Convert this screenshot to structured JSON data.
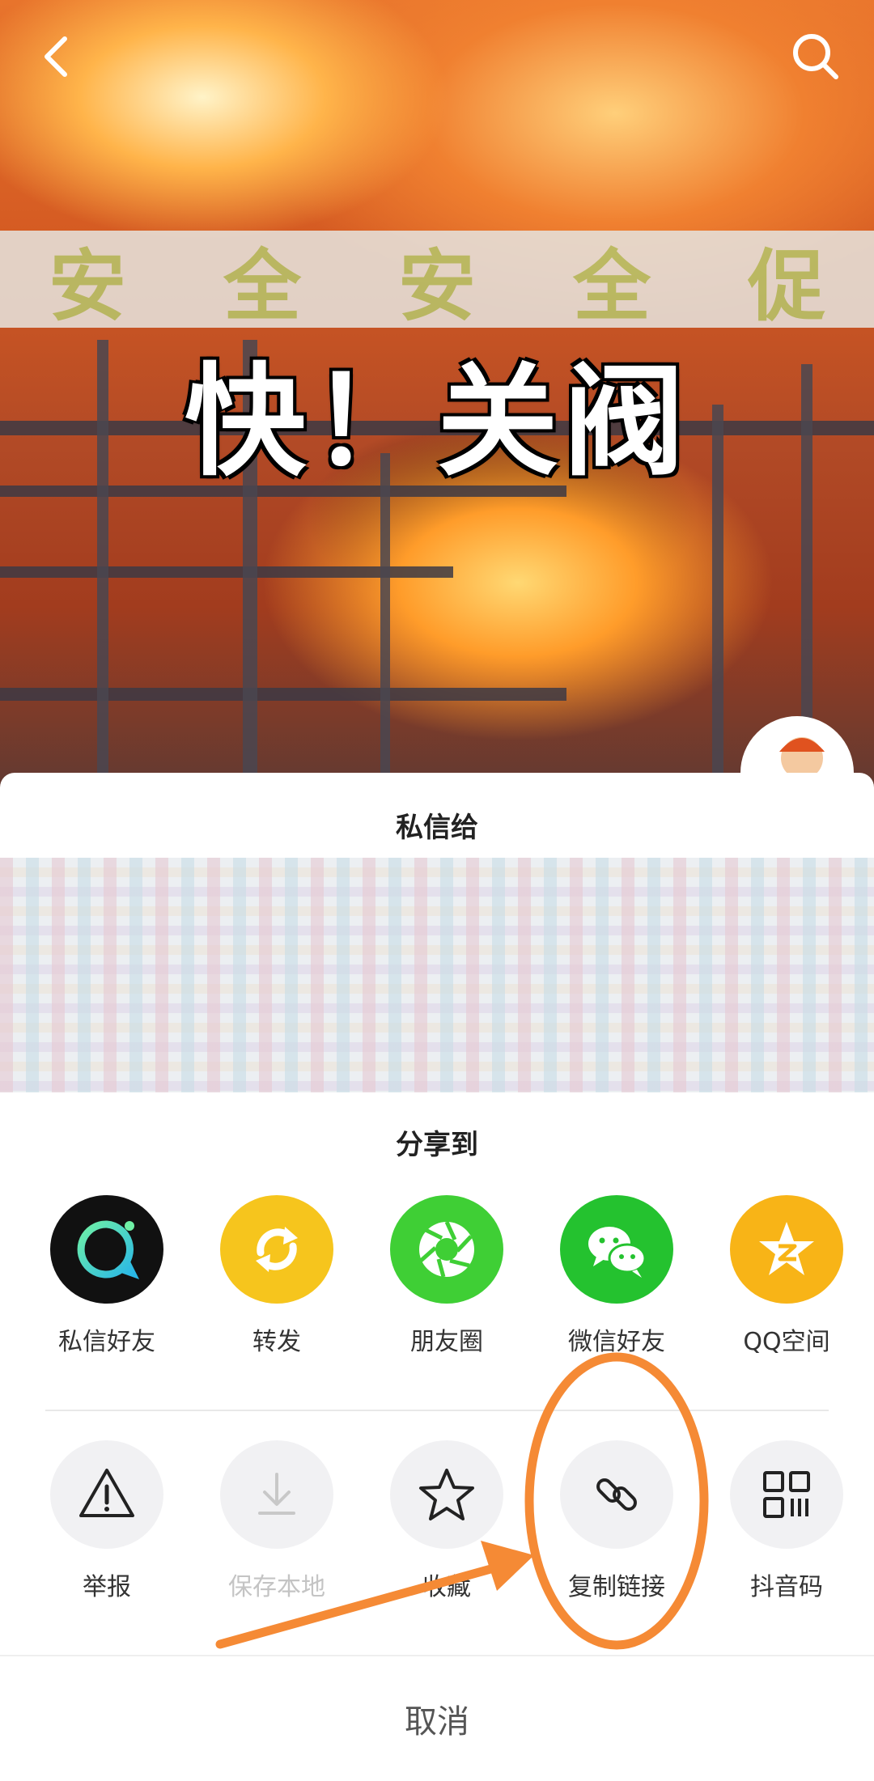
{
  "video": {
    "caption": "快！关阀",
    "banner_chars": [
      "安",
      "全",
      "安",
      "全",
      "促"
    ]
  },
  "top_bar": {
    "back_icon": "chevron-left-icon",
    "search_icon": "search-icon"
  },
  "sheet": {
    "dm_title": "私信给",
    "share_title": "分享到",
    "share_targets": [
      {
        "label": "私信好友",
        "icon": "message-circle-icon",
        "color": "#111111"
      },
      {
        "label": "转发",
        "icon": "repost-arrows-icon",
        "color": "#f6c51d"
      },
      {
        "label": "朋友圈",
        "icon": "camera-aperture-icon",
        "color": "#3fcf35"
      },
      {
        "label": "微信好友",
        "icon": "wechat-icon",
        "color": "#24c22f"
      },
      {
        "label": "QQ空间",
        "icon": "qzone-star-icon",
        "color": "#f8b417"
      }
    ],
    "actions": [
      {
        "label": "举报",
        "icon": "warning-triangle-icon",
        "disabled": false
      },
      {
        "label": "保存本地",
        "icon": "download-icon",
        "disabled": true
      },
      {
        "label": "收藏",
        "icon": "star-icon",
        "disabled": false
      },
      {
        "label": "复制链接",
        "icon": "link-icon",
        "disabled": false
      },
      {
        "label": "抖音码",
        "icon": "qr-code-icon",
        "disabled": false
      }
    ],
    "cancel_label": "取消"
  },
  "colors": {
    "annotation": "#f58a35",
    "sheet_bg": "#ffffff"
  }
}
